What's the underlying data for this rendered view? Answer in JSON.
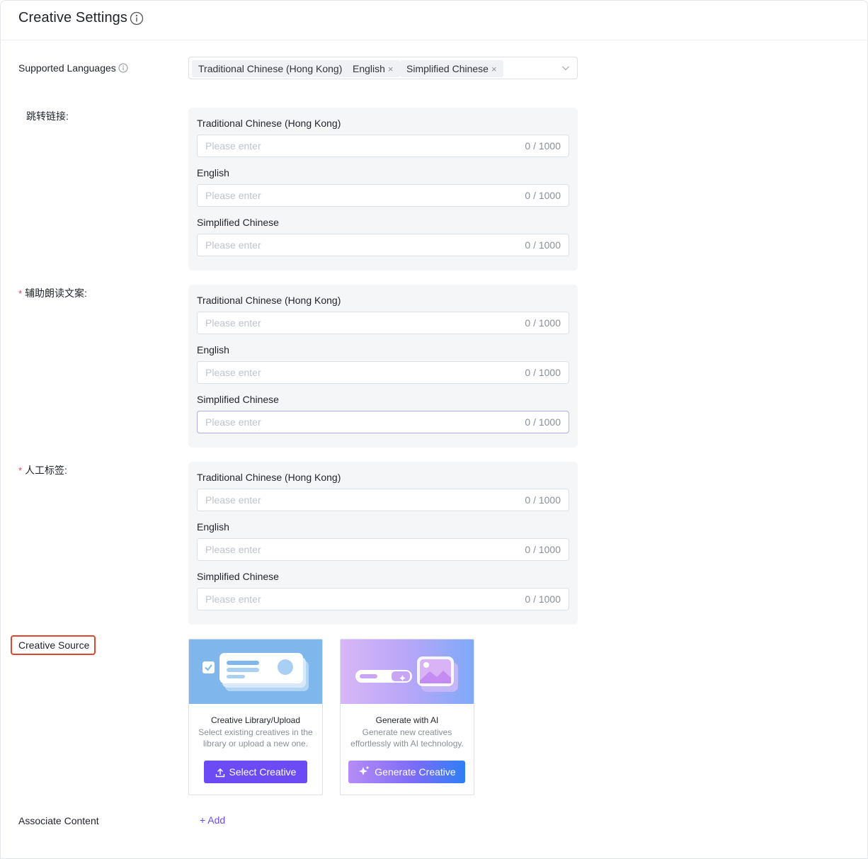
{
  "header": {
    "title": "Creative Settings",
    "info_icon": "info-icon"
  },
  "supported_languages": {
    "label": "Supported Languages",
    "tags": [
      {
        "label": "Traditional Chinese (Hong Kong)",
        "removable": false
      },
      {
        "label": "English",
        "removable": true
      },
      {
        "label": "Simplified Chinese",
        "removable": true
      }
    ],
    "remove_glyph": "×"
  },
  "groups": [
    {
      "label": "跳转链接:",
      "required": false,
      "fields": [
        {
          "label": "Traditional Chinese (Hong Kong)",
          "placeholder": "Please enter",
          "counter": "0 / 1000"
        },
        {
          "label": "English",
          "placeholder": "Please enter",
          "counter": "0 / 1000"
        },
        {
          "label": "Simplified Chinese",
          "placeholder": "Please enter",
          "counter": "0 / 1000"
        }
      ]
    },
    {
      "label": "辅助朗读文案:",
      "required": true,
      "fields": [
        {
          "label": "Traditional Chinese (Hong Kong)",
          "placeholder": "Please enter",
          "counter": "0 / 1000"
        },
        {
          "label": "English",
          "placeholder": "Please enter",
          "counter": "0 / 1000"
        },
        {
          "label": "Simplified Chinese",
          "placeholder": "Please enter",
          "counter": "0 / 1000"
        }
      ]
    },
    {
      "label": "人工标签:",
      "required": true,
      "fields": [
        {
          "label": "Traditional Chinese (Hong Kong)",
          "placeholder": "Please enter",
          "counter": "0 / 1000"
        },
        {
          "label": "English",
          "placeholder": "Please enter",
          "counter": "0 / 1000"
        },
        {
          "label": "Simplified Chinese",
          "placeholder": "Please enter",
          "counter": "0 / 1000"
        }
      ]
    }
  ],
  "required_mark": "*",
  "creative_source": {
    "label": "Creative Source",
    "cards": [
      {
        "title": "Creative Library/Upload",
        "description": "Select existing creatives in the library or upload a new one.",
        "button": "Select Creative"
      },
      {
        "title": "Generate with AI",
        "description": "Generate new creatives effortlessly with AI technology.",
        "button": "Generate Creative"
      }
    ]
  },
  "associate_content": {
    "label": "Associate Content",
    "add_label": "+ Add"
  },
  "colors": {
    "accent": "#6c4bf5",
    "required": "#e34d59",
    "highlight": "#e0462f"
  }
}
